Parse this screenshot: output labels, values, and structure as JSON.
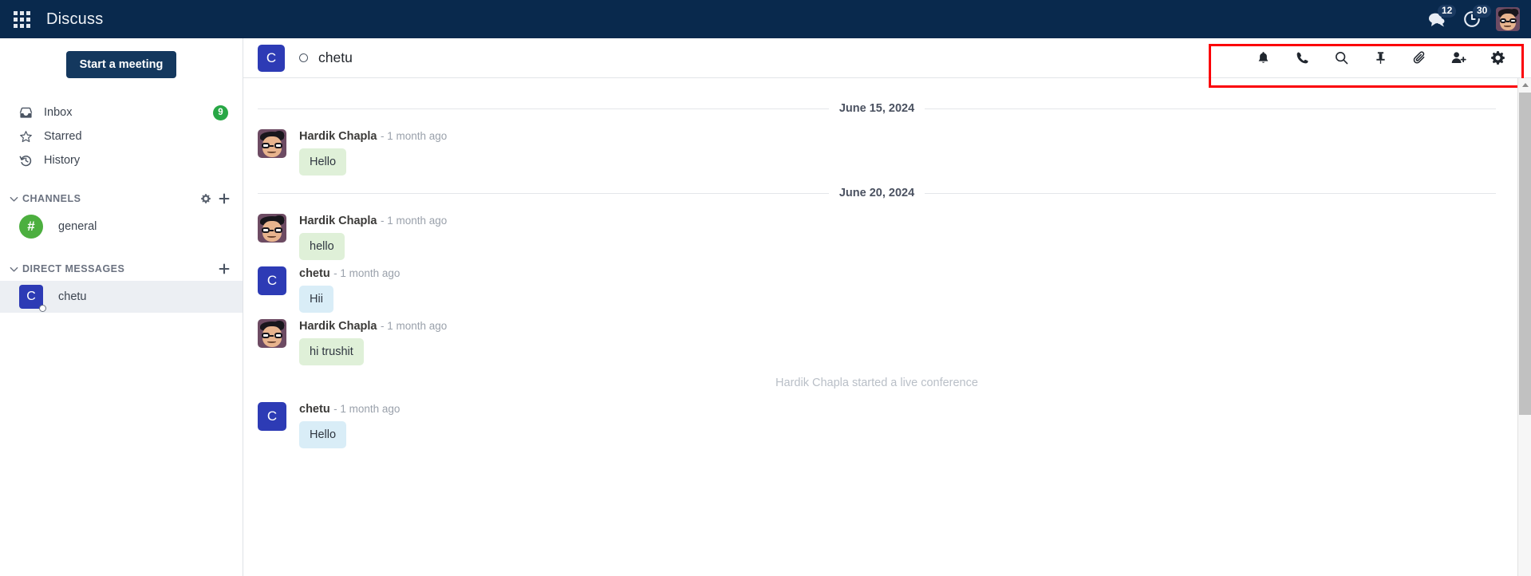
{
  "navbar": {
    "apps_icon": "apps-grid-icon",
    "title": "Discuss",
    "messages_icon": "chat-bubble-icon",
    "messages_count": "12",
    "activities_icon": "clock-activity-icon",
    "activities_count": "30",
    "avatar_icon": "user-avatar"
  },
  "sidebar": {
    "start_meeting_label": "Start a meeting",
    "nav_items": [
      {
        "label": "Inbox",
        "icon": "inbox-icon",
        "badge": "9"
      },
      {
        "label": "Starred",
        "icon": "star-icon",
        "badge": ""
      },
      {
        "label": "History",
        "icon": "history-icon",
        "badge": ""
      }
    ],
    "channels": {
      "section_label": "CHANNELS",
      "gear_icon": "gear-icon",
      "add_icon": "plus-icon",
      "items": [
        {
          "label": "general",
          "avatar": "#",
          "color": "#4caf3f"
        }
      ]
    },
    "direct_messages": {
      "section_label": "DIRECT MESSAGES",
      "add_icon": "plus-icon",
      "items": [
        {
          "label": "chetu",
          "avatar": "C",
          "color": "#2d3bb5",
          "active": true
        }
      ]
    }
  },
  "thread": {
    "header": {
      "avatar_letter": "C",
      "title": "chetu",
      "status": "offline",
      "actions": [
        {
          "name": "notification-bell-icon",
          "label": "Notification Settings"
        },
        {
          "name": "phone-call-icon",
          "label": "Start a Call"
        },
        {
          "name": "search-icon",
          "label": "Search Messages"
        },
        {
          "name": "pin-icon",
          "label": "Pinned Messages"
        },
        {
          "name": "paperclip-attachment-icon",
          "label": "Attachments"
        },
        {
          "name": "add-user-icon",
          "label": "Add Users"
        },
        {
          "name": "gear-settings-icon",
          "label": "Thread Settings"
        }
      ]
    },
    "groups": [
      {
        "date": "June 15, 2024",
        "messages": [
          {
            "author": "Hardik Chapla",
            "time": "- 1 month ago",
            "text": "Hello",
            "avatar_type": "photo",
            "bubble": "green"
          }
        ]
      },
      {
        "date": "June 20, 2024",
        "messages": [
          {
            "author": "Hardik Chapla",
            "time": "- 1 month ago",
            "text": "hello",
            "avatar_type": "photo",
            "bubble": "green"
          },
          {
            "author": "chetu",
            "time": "- 1 month ago",
            "text": "Hii",
            "avatar_type": "letter",
            "avatar_letter": "C",
            "bubble": "blue"
          },
          {
            "author": "Hardik Chapla",
            "time": "- 1 month ago",
            "text": "hi trushit",
            "avatar_type": "photo",
            "bubble": "green"
          }
        ],
        "notice": "Hardik Chapla started a live conference",
        "after_notice": [
          {
            "author": "chetu",
            "time": "- 1 month ago",
            "text": "Hello",
            "avatar_type": "letter",
            "avatar_letter": "C",
            "bubble": "blue"
          }
        ]
      }
    ]
  },
  "scrollbar": {
    "up_arrow_icon": "scroll-up-arrow-icon",
    "thumb": "scroll-thumb"
  },
  "annotation": {
    "highlight_color": "#fb0007"
  }
}
